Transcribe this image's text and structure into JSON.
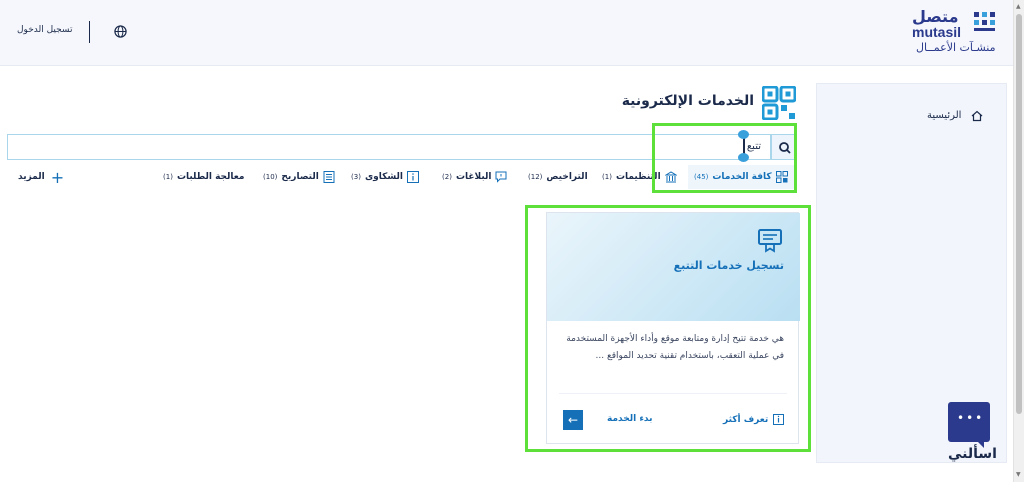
{
  "header": {
    "login_label": "تسجيل الدخول",
    "language_icon": "globe-icon",
    "logo_ar": "متصل",
    "logo_en": "mutasil",
    "logo_sub": "منشـآت الأعمــال"
  },
  "sidebar": {
    "home_label": "الرئيسية",
    "chat_label": "اسألني"
  },
  "main": {
    "title": "الخدمات الإلكترونية",
    "search": {
      "value": "تتبع"
    },
    "tabs": [
      {
        "label": "كافة الخدمات",
        "count": "(45)",
        "icon": "grid-icon",
        "active": true
      },
      {
        "label": "التنظيمات",
        "count": "(1)",
        "icon": "bank-icon"
      },
      {
        "label": "التراخيص",
        "count": "(12)",
        "icon": ""
      },
      {
        "label": "البلاغات",
        "count": "(2)",
        "icon": "report-icon"
      },
      {
        "label": "الشكاوى",
        "count": "(3)",
        "icon": "info-icon"
      },
      {
        "label": "التصاريح",
        "count": "(10)",
        "icon": "document-icon"
      },
      {
        "label": "معالجة الطلبات",
        "count": "(1)",
        "icon": ""
      }
    ],
    "more_label": "المزيد"
  },
  "card": {
    "title": "تسجيل خدمات التتبع",
    "description": "هي خدمة تتيح إدارة ومتابعة موقع وأداء الأجهزة المستخدمة في عملية التعقب، باستخدام تقنية تحديد المواقع ...",
    "learn_more": "تعرف أكثر",
    "start_service": "بدء الخدمة"
  },
  "colors": {
    "accent": "#1570b8",
    "brand": "#2b3a8c",
    "highlight": "#5ee03a"
  }
}
